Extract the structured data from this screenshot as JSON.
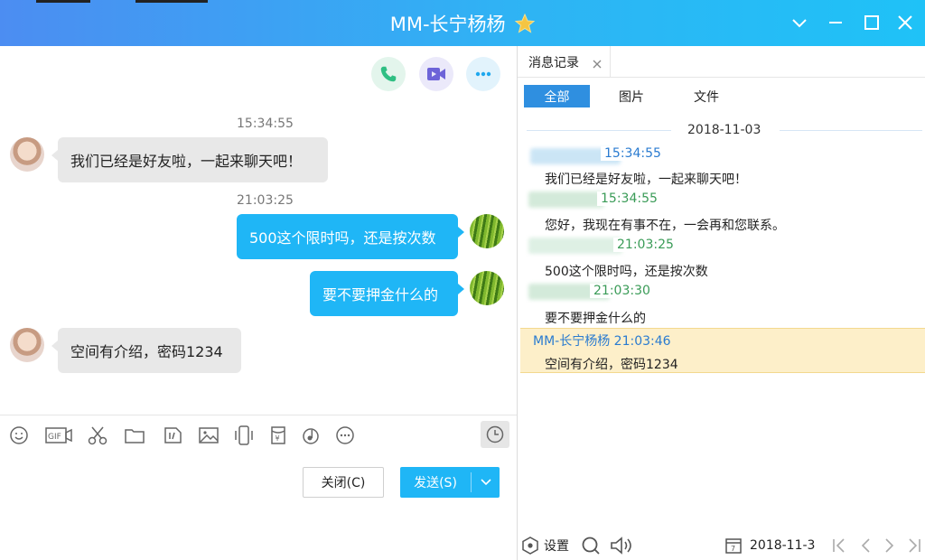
{
  "window": {
    "title": "MM-长宁杨杨",
    "controls": [
      "chevron-down",
      "minimize",
      "maximize",
      "close"
    ]
  },
  "chat": {
    "top_actions": [
      "phone-icon",
      "video-icon",
      "more-icon"
    ],
    "messages": [
      {
        "time": "15:34:55",
        "side": "in",
        "text": "我们已经是好友啦，一起来聊天吧！"
      },
      {
        "time": "21:03:25",
        "side": "out",
        "text": "500这个限时吗，还是按次数"
      },
      {
        "time": "",
        "side": "out",
        "text": "要不要押金什么的"
      },
      {
        "time": "",
        "side": "in",
        "text": "空间有介绍，密码1234"
      }
    ]
  },
  "toolbar": {
    "icons": [
      "emoji-icon",
      "gif-icon",
      "scissors-icon",
      "folder-icon",
      "sticker-icon",
      "image-icon",
      "shake-icon",
      "red-packet-icon",
      "music-icon",
      "more-icon",
      "history-clock-icon"
    ]
  },
  "buttons": {
    "close_label": "关闭(C)",
    "send_label": "发送(S)"
  },
  "history": {
    "tab_label": "消息记录",
    "filters": [
      "全部",
      "图片",
      "文件"
    ],
    "date": "2018-11-03",
    "entries": [
      {
        "header": "15:34:55",
        "text": "我们已经是好友啦，一起来聊天吧！"
      },
      {
        "header": "15:34:55",
        "text": "您好，我现在有事不在，一会再和您联系。"
      },
      {
        "header": "21:03:25",
        "text": "500这个限时吗，还是按次数"
      },
      {
        "header": "21:03:30",
        "text": "要不要押金什么的"
      },
      {
        "header": "MM-长宁杨杨 21:03:46",
        "text": "空间有介绍，密码1234"
      }
    ],
    "footer": {
      "settings_label": "设置",
      "date_value": "2018-11-3"
    }
  },
  "colors": {
    "accent": "#1fb6f6",
    "history_header_green": "#3a9b57",
    "history_header_blue": "#2a7bd0",
    "highlight": "#fdefc9"
  }
}
